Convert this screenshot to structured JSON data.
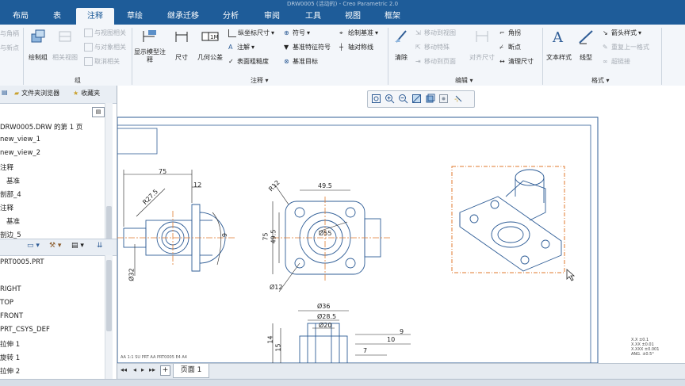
{
  "window": {
    "title": "DRW0005 (活动的) - Creo Parametric 2.0"
  },
  "tabs": [
    "布局",
    "表",
    "注释",
    "草绘",
    "继承迁移",
    "分析",
    "审阅",
    "工具",
    "视图",
    "框架"
  ],
  "active_tab": "注释",
  "ribbon": {
    "group1": {
      "items": [
        "与角柄",
        "与新点"
      ]
    },
    "group_zu": {
      "label": "组",
      "big": [
        "绘制组",
        "相关视图"
      ],
      "small": [
        "与视图相关",
        "与对象相关",
        "取消相关"
      ]
    },
    "show_model_annotations": "显示模型注释",
    "annotation": {
      "label": "注释",
      "big": [
        "尺寸",
        "几何公差"
      ],
      "small_col1": [
        "纵坐标尺寸",
        "注解",
        "表面粗糙度"
      ],
      "small_col2": [
        "符号",
        "基准特征符号",
        "基准目标"
      ],
      "small_col3": [
        "绘制基准",
        "轴对称线"
      ]
    },
    "edit": {
      "label": "编辑",
      "big": [
        "清除",
        "对齐尺寸"
      ],
      "small_col1": [
        "移动到视图",
        "移动特殊",
        "移动到页面"
      ],
      "small_col2": [
        "角拐",
        "断点",
        "清理尺寸"
      ]
    },
    "format": {
      "label": "格式",
      "big": [
        "文本样式",
        "线型"
      ],
      "small": [
        "箭头样式",
        "重复上一格式",
        "超链接"
      ]
    }
  },
  "left_panel": {
    "tabs": [
      "文件夹浏览器",
      "收藏夹"
    ],
    "tree_top": [
      "DRW0005.DRW 的第 1 页",
      "new_view_1",
      "new_view_2",
      "注释",
      "基准",
      "剖部_4",
      "注释",
      "基准",
      "剖边_5"
    ],
    "tree_bottom": [
      "PRT0005.PRT",
      "RIGHT",
      "TOP",
      "FRONT",
      "PRT_CSYS_DEF",
      "拉伸 1",
      "旋转 1",
      "拉伸 2"
    ]
  },
  "sheet_tab": "页面 1",
  "drawing": {
    "dims": {
      "d75_top": "75",
      "d12_a": "12",
      "dr27": "R27.5",
      "d6": "6",
      "d32": "Ø32",
      "d49": "49.5",
      "dr12": "R12",
      "d75_side": "75",
      "d49_side": "49.5",
      "d55": "Ø55",
      "d12_hole": "Ø12",
      "d36": "Ø36",
      "d28": "Ø28.5",
      "d20": "Ø20",
      "d9": "9",
      "d10": "10",
      "d7": "7",
      "d14": "14",
      "d15": "15"
    },
    "note_lines": [
      "X.X  ±0.1",
      "X.XX  ±0.01",
      "X.XXX  ±0.001",
      "ANG.  ±0.5°"
    ],
    "title_note": "AA  1:1   SU  PRT   AA  PRT0005   E4   A4"
  },
  "colors": {
    "accent": "#1e5c99",
    "geometry": "#2f5d96",
    "dimension": "#222222",
    "selection": "#e07a2e"
  }
}
